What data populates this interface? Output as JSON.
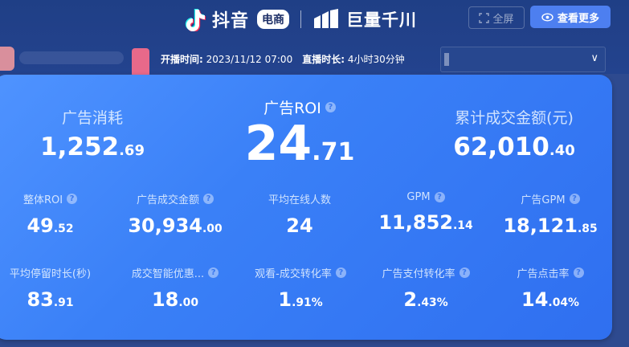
{
  "header": {
    "douyin": "抖音",
    "badge": "电商",
    "qianchuan": "巨量千川",
    "fullscreen": "全屏",
    "more": "查看更多"
  },
  "meta": {
    "start_label": "开播时间:",
    "start_value": "2023/11/12 07:00",
    "duration_label": "直播时长:",
    "duration_value": "4小时30分钟"
  },
  "top": {
    "ad_spend": {
      "label": "广告消耗",
      "int": "1,252",
      "dec": ".69"
    },
    "ad_roi": {
      "label": "广告ROI",
      "int": "24",
      "dec": ".71"
    },
    "gmv": {
      "label": "累计成交金额(元)",
      "int": "62,010",
      "dec": ".40"
    }
  },
  "row2": [
    {
      "label": "整体ROI",
      "int": "49",
      "dec": ".52"
    },
    {
      "label": "广告成交金额",
      "int": "30,934",
      "dec": ".00"
    },
    {
      "label": "平均在线人数",
      "int": "24",
      "dec": ""
    },
    {
      "label": "GPM",
      "int": "11,852",
      "dec": ".14"
    },
    {
      "label": "广告GPM",
      "int": "18,121",
      "dec": ".85"
    }
  ],
  "row3": [
    {
      "label": "平均停留时长(秒)",
      "int": "83",
      "dec": ".91"
    },
    {
      "label": "成交智能优惠...",
      "int": "18",
      "dec": ".00"
    },
    {
      "label": "观看-成交转化率",
      "int": "1",
      "dec": ".91%"
    },
    {
      "label": "广告支付转化率",
      "int": "2",
      "dec": ".43%"
    },
    {
      "label": "广告点击率",
      "int": "14",
      "dec": ".04%"
    }
  ],
  "icons": [
    "tiktok-icon",
    "juliang-icon",
    "fullscreen-icon",
    "eye-icon",
    "chevron-down-icon",
    "help-icon"
  ]
}
